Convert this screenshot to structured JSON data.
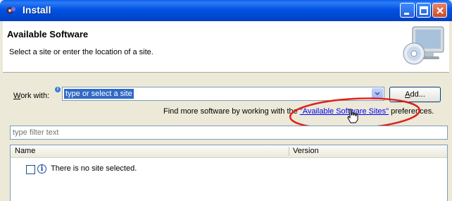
{
  "window": {
    "title": "Install"
  },
  "header": {
    "title": "Available Software",
    "description": "Select a site or enter the location of a site."
  },
  "work_with": {
    "label_underlined": "W",
    "label_rest": "ork with:",
    "combo_value": "type or select a site"
  },
  "add_button": {
    "label_underlined": "A",
    "label_rest": "dd..."
  },
  "find_more": {
    "prefix": "Find more software by working with the ",
    "link": "\"Available Software Sites\"",
    "suffix": " preferences."
  },
  "filter": {
    "placeholder": "type filter text"
  },
  "table": {
    "columns": [
      "Name",
      "Version"
    ],
    "rows": [
      {
        "text": "There is no site selected.",
        "checked": false
      }
    ]
  },
  "colors": {
    "titlebar": "#0052e2",
    "selection": "#316ac5",
    "annotation": "#e0201c",
    "link": "#0000ee"
  }
}
